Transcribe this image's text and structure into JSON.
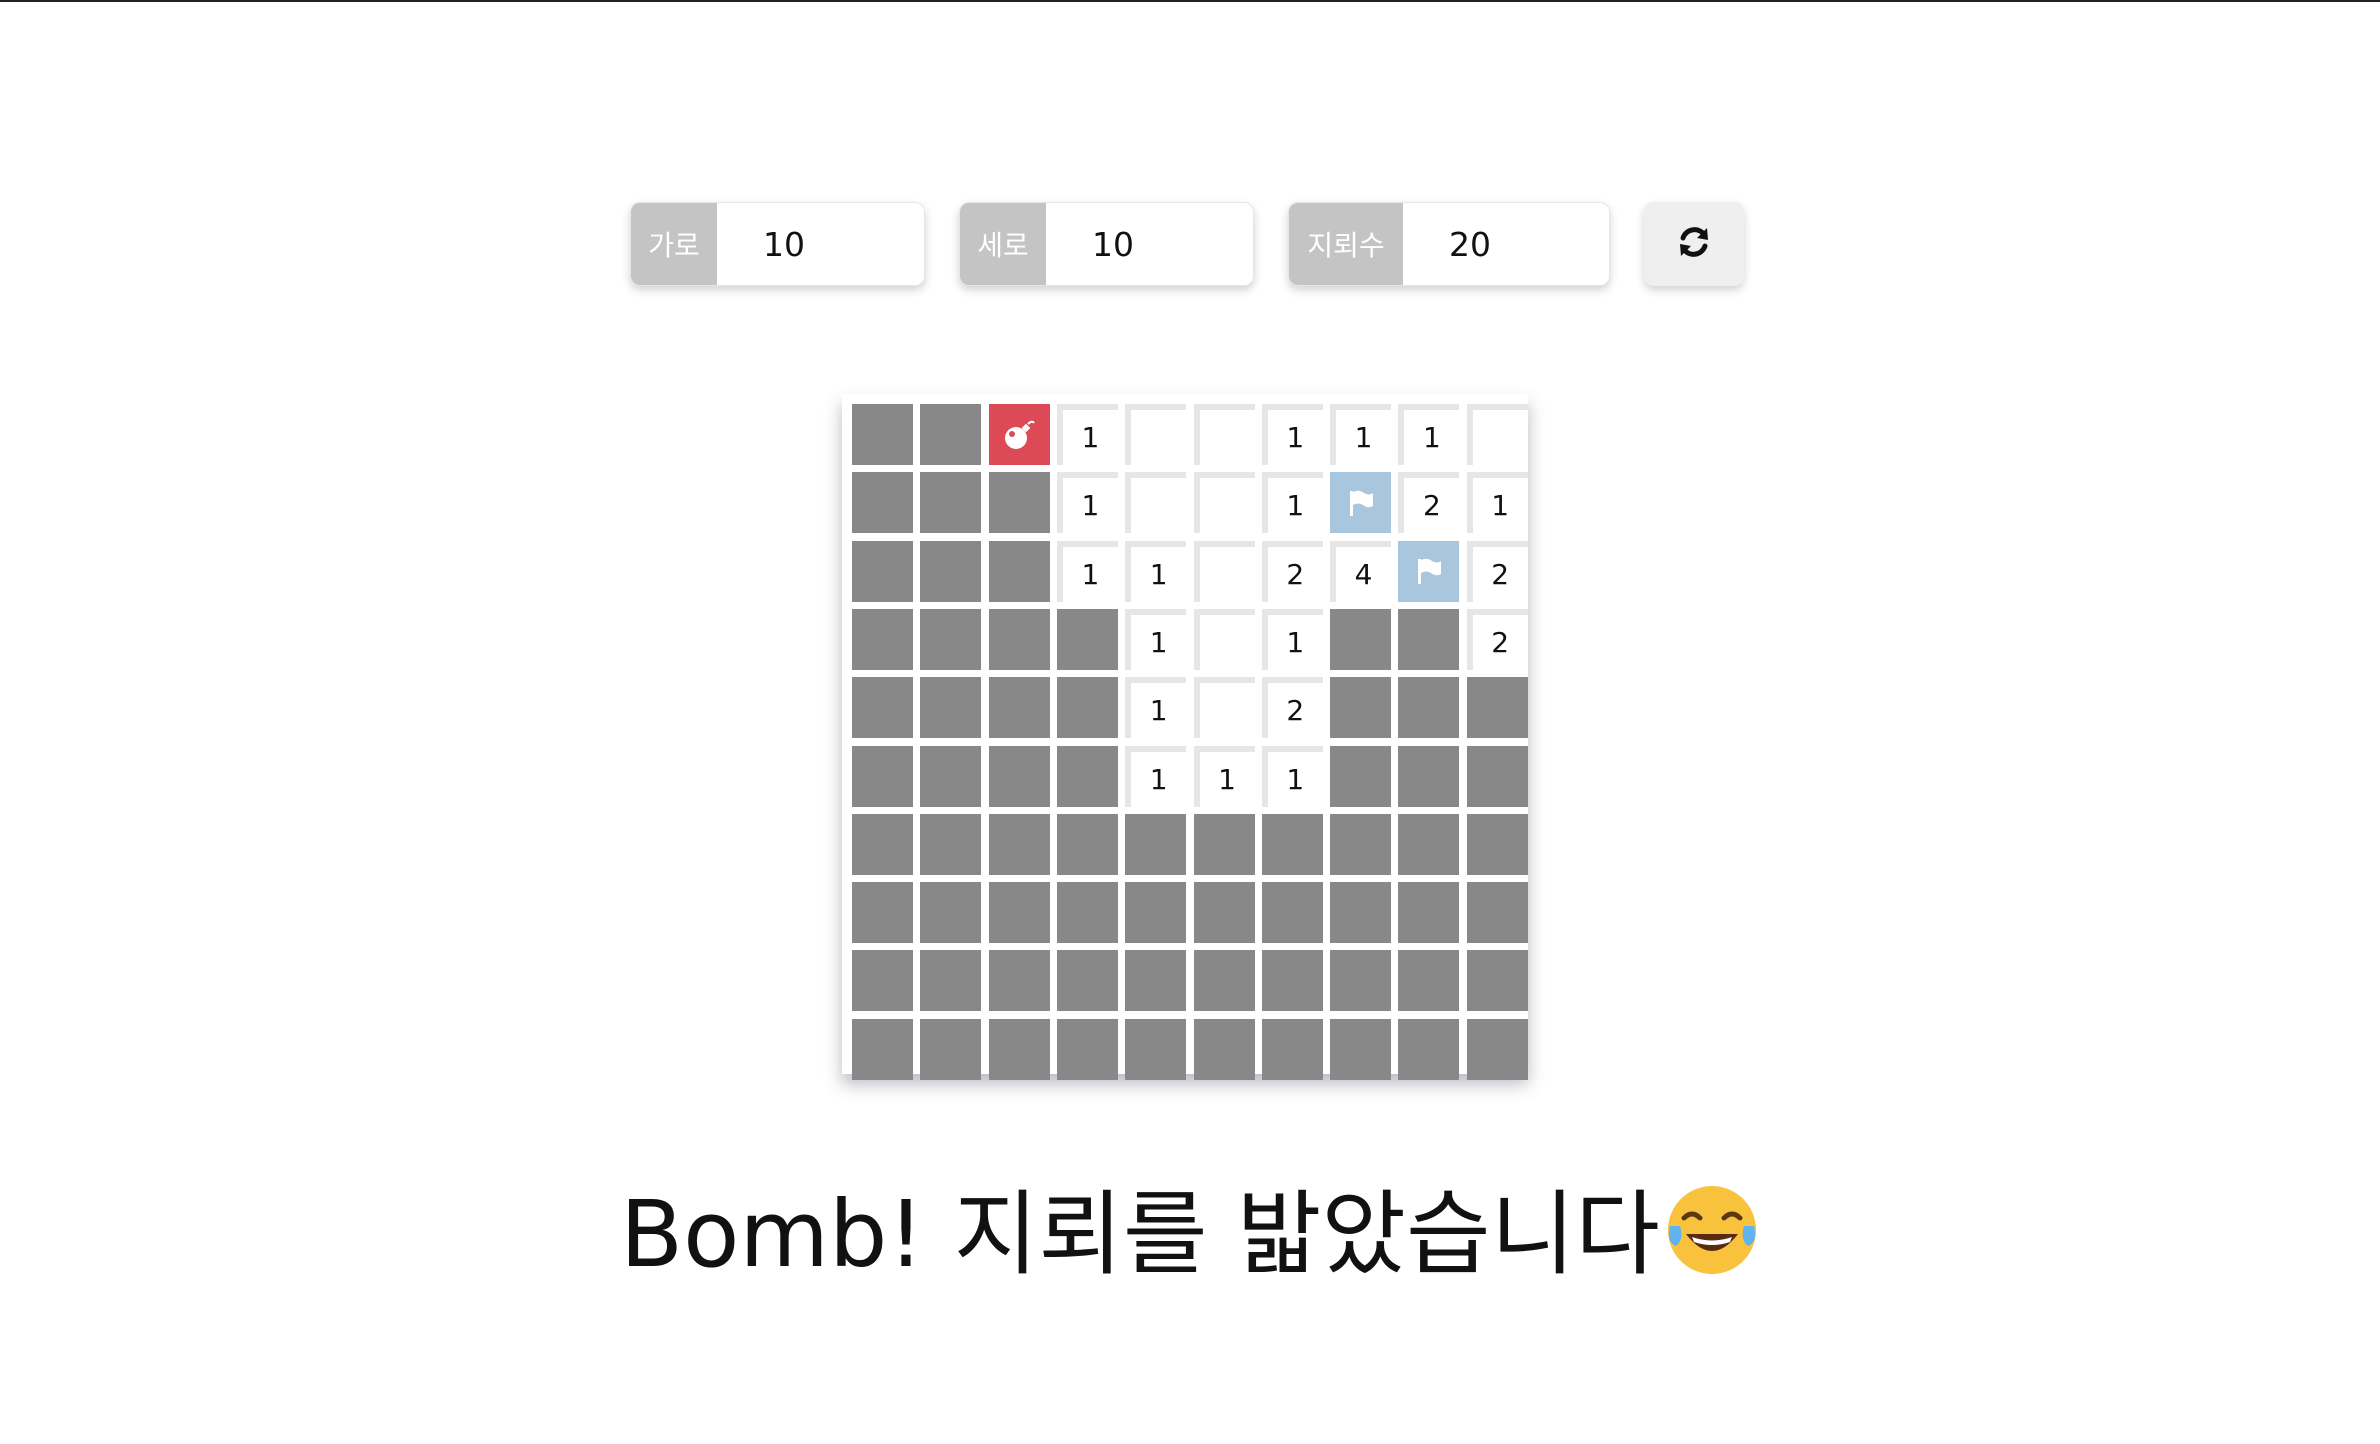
{
  "controls": {
    "width": {
      "label": "가로",
      "value": "10"
    },
    "height": {
      "label": "세로",
      "value": "10"
    },
    "mines": {
      "label": "지뢰수",
      "value": "20"
    },
    "refresh_icon": "refresh-icon"
  },
  "board": {
    "rows": [
      [
        "H",
        "H",
        "B",
        "1",
        "",
        "",
        "1",
        "1",
        "1",
        ""
      ],
      [
        "H",
        "H",
        "H",
        "1",
        "",
        "",
        "1",
        "F",
        "2",
        "1"
      ],
      [
        "H",
        "H",
        "H",
        "1",
        "1",
        "",
        "2",
        "4",
        "F",
        "2"
      ],
      [
        "H",
        "H",
        "H",
        "H",
        "1",
        "",
        "1",
        "H",
        "H",
        "2"
      ],
      [
        "H",
        "H",
        "H",
        "H",
        "1",
        "",
        "2",
        "H",
        "H",
        "H"
      ],
      [
        "H",
        "H",
        "H",
        "H",
        "1",
        "1",
        "1",
        "H",
        "H",
        "H"
      ],
      [
        "H",
        "H",
        "H",
        "H",
        "H",
        "H",
        "H",
        "H",
        "H",
        "H"
      ],
      [
        "H",
        "H",
        "H",
        "H",
        "H",
        "H",
        "H",
        "H",
        "H",
        "H"
      ],
      [
        "H",
        "H",
        "H",
        "H",
        "H",
        "H",
        "H",
        "H",
        "H",
        "H"
      ],
      [
        "H",
        "H",
        "H",
        "H",
        "H",
        "H",
        "H",
        "H",
        "H",
        "H"
      ]
    ],
    "colors": {
      "hidden": "#888888",
      "bomb": "#dc4a55",
      "flag": "#a8c6de"
    }
  },
  "message": {
    "text": "Bomb! 지뢰를 밟았습니다",
    "emoji": "face-with-tears-of-joy-icon"
  }
}
